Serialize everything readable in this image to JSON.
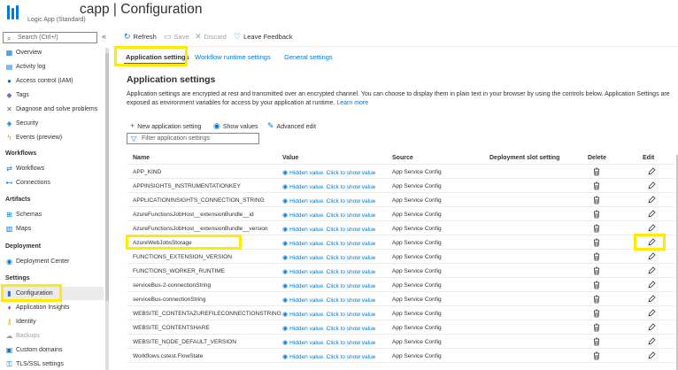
{
  "app": {
    "title": "capp | Configuration",
    "subtitle": "Logic App (Standard)",
    "more": "···"
  },
  "sidebar": {
    "search_placeholder": "Search (Ctrl+/)",
    "collapse": "«",
    "items": [
      {
        "label": "Overview",
        "icon": "overview-icon",
        "glyph": "▦",
        "color": "#0078d4"
      },
      {
        "label": "Activity log",
        "icon": "activity-log-icon",
        "glyph": "▤",
        "color": "#0078d4"
      },
      {
        "label": "Access control (IAM)",
        "icon": "iam-icon",
        "glyph": "●",
        "color": "#0078d4"
      },
      {
        "label": "Tags",
        "icon": "tag-icon",
        "glyph": "◆",
        "color": "#8764b8"
      },
      {
        "label": "Diagnose and solve problems",
        "icon": "wrench-icon",
        "glyph": "✕",
        "color": "#605e5c"
      },
      {
        "label": "Security",
        "icon": "shield-icon",
        "glyph": "◈",
        "color": "#0078d4"
      },
      {
        "label": "Events (preview)",
        "icon": "lightning-icon",
        "glyph": "ϟ",
        "color": "#e8a400"
      }
    ],
    "sections": {
      "workflows": {
        "title": "Workflows",
        "items": [
          {
            "label": "Workflows",
            "icon": "workflows-icon",
            "glyph": "⇄",
            "color": "#0078d4"
          },
          {
            "label": "Connections",
            "icon": "connections-icon",
            "glyph": "⊷",
            "color": "#0078d4"
          }
        ]
      },
      "artifacts": {
        "title": "Artifacts",
        "items": [
          {
            "label": "Schemas",
            "icon": "schemas-icon",
            "glyph": "⊞",
            "color": "#0078d4"
          },
          {
            "label": "Maps",
            "icon": "maps-icon",
            "glyph": "▥",
            "color": "#0078d4"
          }
        ]
      },
      "deployment": {
        "title": "Deployment",
        "items": [
          {
            "label": "Deployment Center",
            "icon": "deployment-center-icon",
            "glyph": "◉",
            "color": "#0078d4"
          }
        ]
      },
      "settings": {
        "title": "Settings",
        "items": [
          {
            "label": "Configuration",
            "icon": "configuration-icon",
            "glyph": "▮",
            "color": "#0078d4"
          },
          {
            "label": "Application Insights",
            "icon": "app-insights-icon",
            "glyph": "♦",
            "color": "#8764b8"
          },
          {
            "label": "Identity",
            "icon": "identity-icon",
            "glyph": "⚷",
            "color": "#e8a400"
          },
          {
            "label": "Backups",
            "icon": "backups-icon",
            "glyph": "☁",
            "color": "#a19f9d"
          },
          {
            "label": "Custom domains",
            "icon": "custom-domains-icon",
            "glyph": "▣",
            "color": "#0078d4"
          },
          {
            "label": "TLS/SSL settings",
            "icon": "tls-icon",
            "glyph": "⚿",
            "color": "#0078d4"
          }
        ]
      }
    }
  },
  "toolbar": {
    "refresh": "Refresh",
    "save": "Save",
    "discard": "Discard",
    "feedback": "Leave Feedback"
  },
  "tabs": [
    "Application settings",
    "Workflow runtime settings",
    "General settings"
  ],
  "main": {
    "heading": "Application settings",
    "description": "Application settings are encrypted at rest and transmitted over an encrypted channel. You can choose to display them in plain text in your browser by using the controls below. Application Settings are exposed as environment variables for access by your application at runtime.",
    "learn_more": "Learn more",
    "new_setting": "New application setting",
    "show_values": "Show values",
    "advanced_edit": "Advanced edit",
    "filter_placeholder": "Filter application settings"
  },
  "table": {
    "headers": {
      "name": "Name",
      "value": "Value",
      "source": "Source",
      "slot": "Deployment slot setting",
      "delete": "Delete",
      "edit": "Edit"
    },
    "hidden_value": "Hidden value. Click to show value",
    "source_value": "App Service Config",
    "rows": [
      "APP_KIND",
      "APPINSIGHTS_INSTRUMENTATIONKEY",
      "APPLICATIONINSIGHTS_CONNECTION_STRING",
      "AzureFunctionsJobHost__extensionBundle__id",
      "AzureFunctionsJobHost__extensionBundle__version",
      "AzureWebJobsStorage",
      "FUNCTIONS_EXTENSION_VERSION",
      "FUNCTIONS_WORKER_RUNTIME",
      "serviceBus-2-connectionString",
      "serviceBus-connectionString",
      "WEBSITE_CONTENTAZUREFILECONNECTIONSTRING",
      "WEBSITE_CONTENTSHARE",
      "WEBSITE_NODE_DEFAULT_VERSION",
      "Workflows.cstest.FlowState"
    ]
  }
}
